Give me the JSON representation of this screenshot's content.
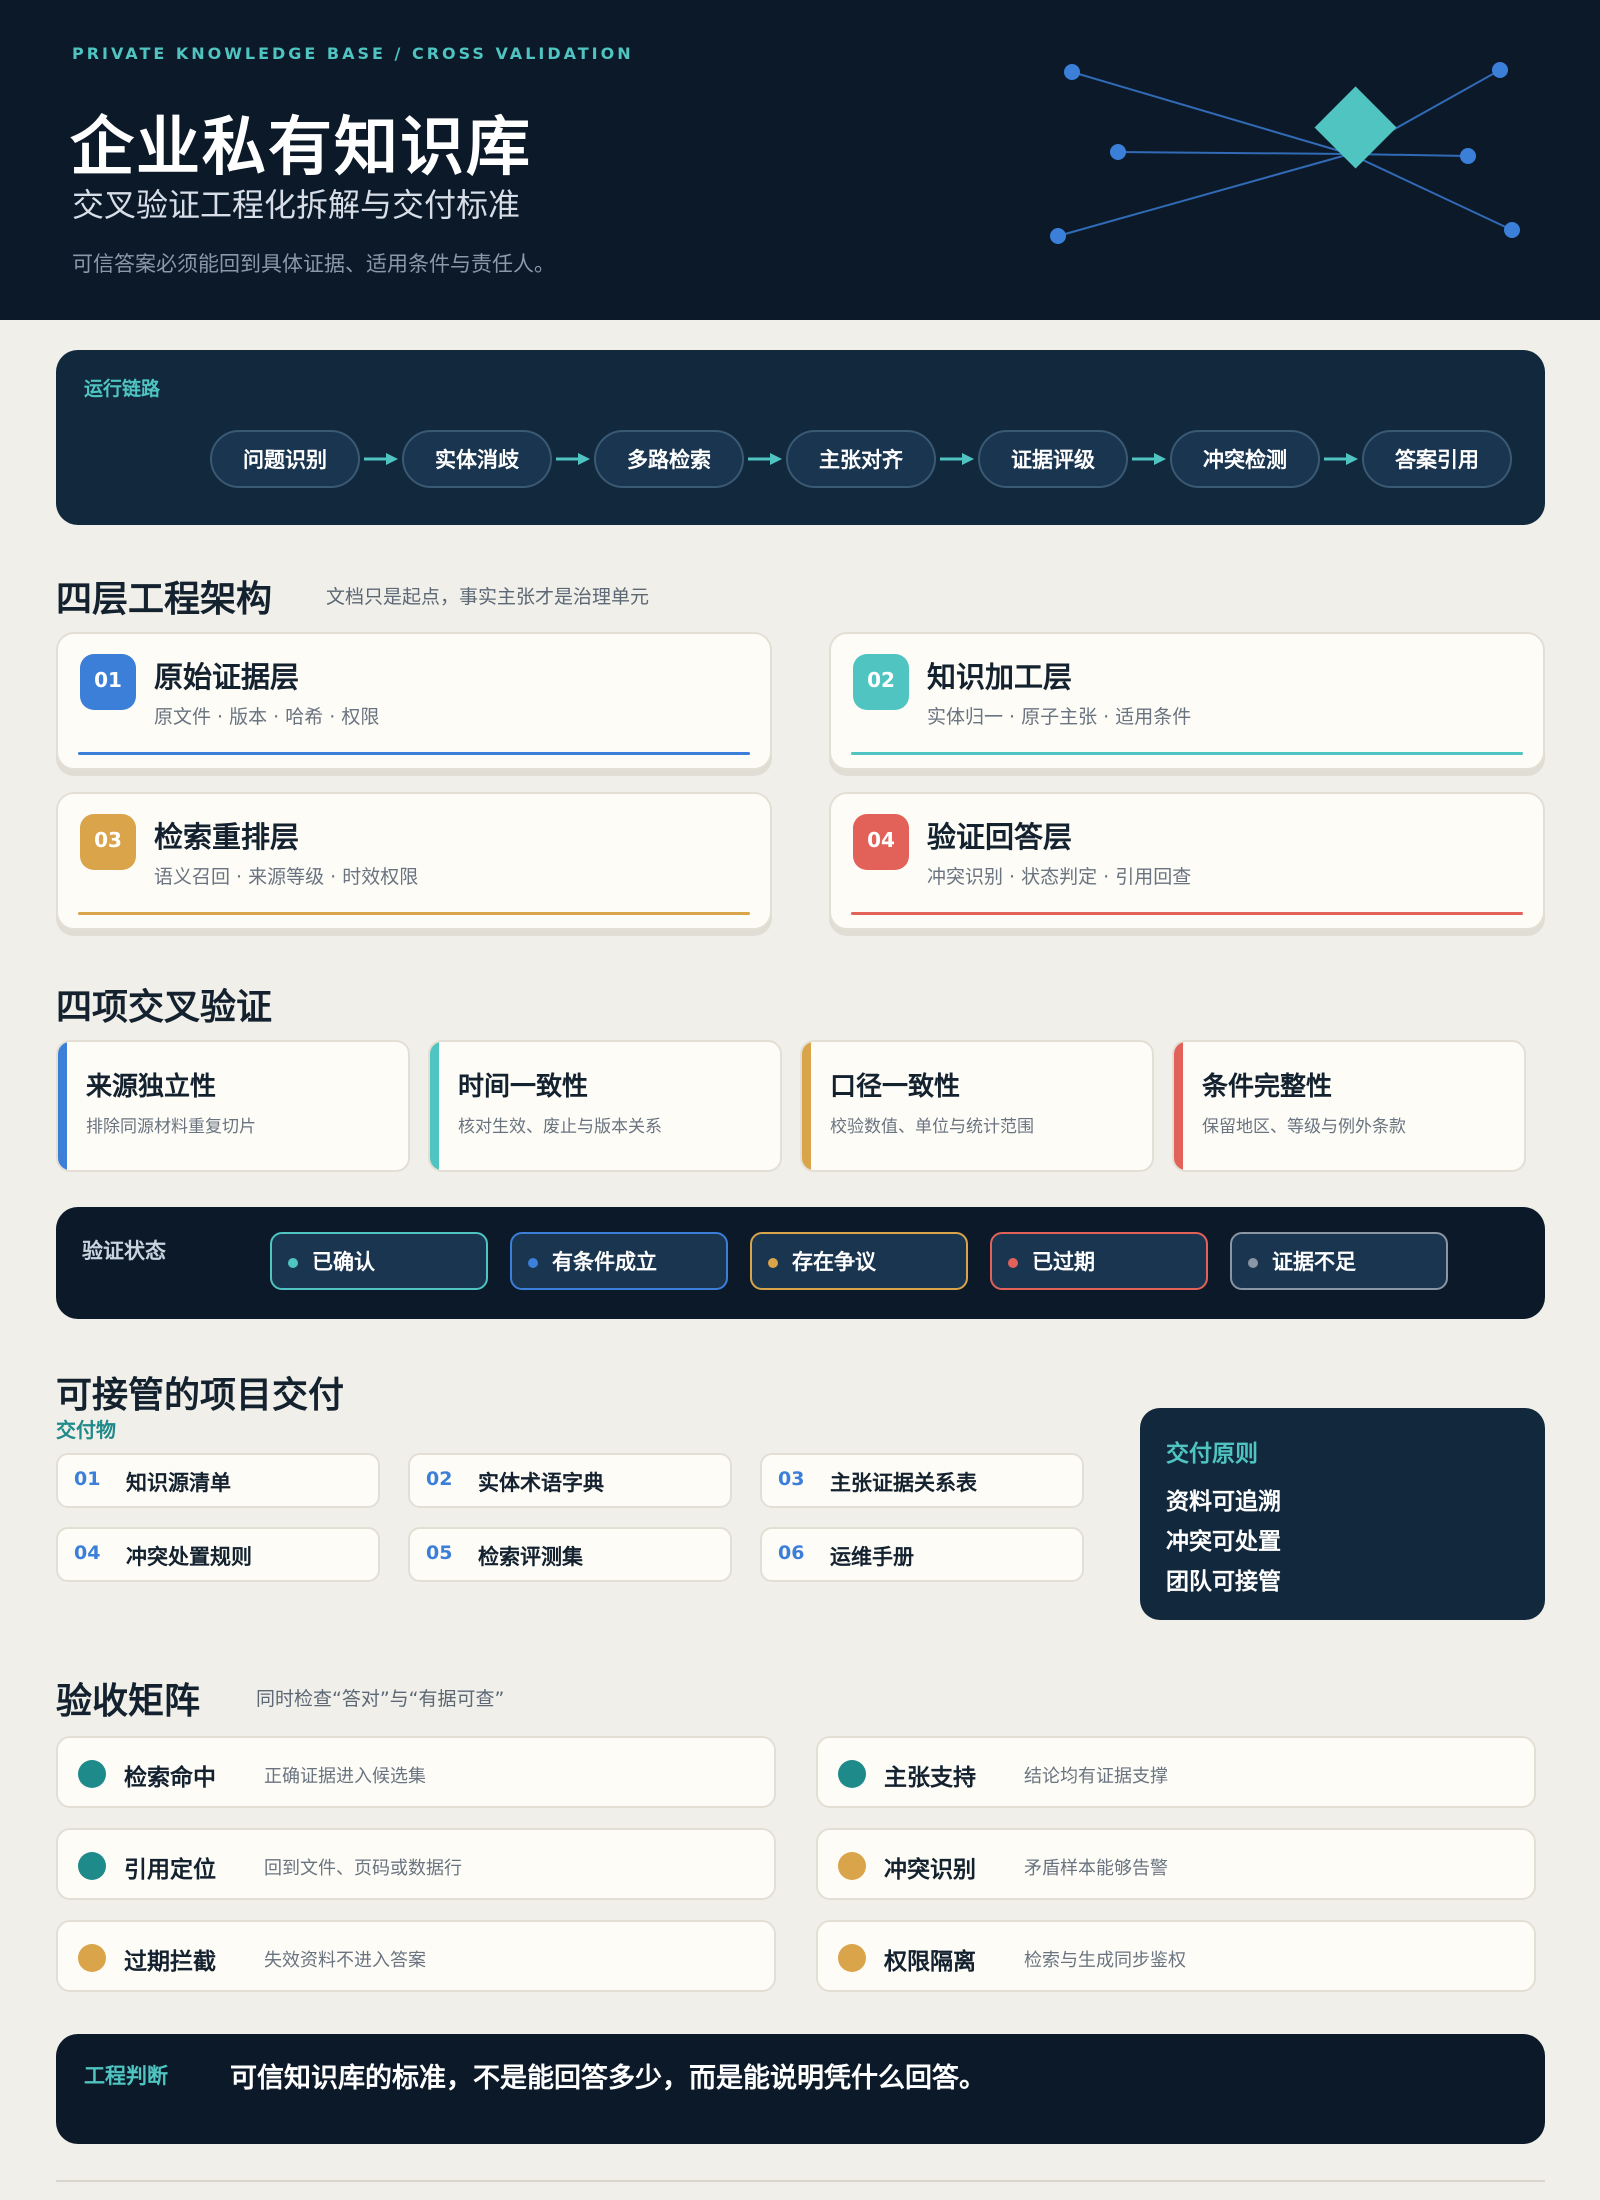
{
  "colors": {
    "navy": "#0b1929",
    "panel": "#12283d",
    "teal": "#4fc4c0",
    "blue": "#3b7fd9",
    "amber": "#d9a44a",
    "coral": "#e2625a",
    "gray": "#8a96a3",
    "deep_teal": "#1f8a8a"
  },
  "hero": {
    "eyebrow": "PRIVATE KNOWLEDGE BASE / CROSS VALIDATION",
    "title": "企业私有知识库",
    "subtitle": "交叉验证工程化拆解与交付标准",
    "tagline": "可信答案必须能回到具体证据、适用条件与责任人。"
  },
  "pipeline": {
    "label": "运行链路",
    "steps": [
      "问题识别",
      "实体消歧",
      "多路检索",
      "主张对齐",
      "证据评级",
      "冲突检测",
      "答案引用"
    ]
  },
  "layers": {
    "title": "四层工程架构",
    "subtitle": "文档只是起点，事实主张才是治理单元",
    "items": [
      {
        "num": "01",
        "title": "原始证据层",
        "desc": "原文件 · 版本 · 哈希 · 权限",
        "color": "#3b7fd9"
      },
      {
        "num": "02",
        "title": "知识加工层",
        "desc": "实体归一 · 原子主张 · 适用条件",
        "color": "#4fc4c0"
      },
      {
        "num": "03",
        "title": "检索重排层",
        "desc": "语义召回 · 来源等级 · 时效权限",
        "color": "#d9a44a"
      },
      {
        "num": "04",
        "title": "验证回答层",
        "desc": "冲突识别 · 状态判定 · 引用回查",
        "color": "#e2625a"
      }
    ]
  },
  "checks": {
    "title": "四项交叉验证",
    "items": [
      {
        "title": "来源独立性",
        "desc": "排除同源材料重复切片",
        "color": "#3b7fd9"
      },
      {
        "title": "时间一致性",
        "desc": "核对生效、废止与版本关系",
        "color": "#4fc4c0"
      },
      {
        "title": "口径一致性",
        "desc": "校验数值、单位与统计范围",
        "color": "#d9a44a"
      },
      {
        "title": "条件完整性",
        "desc": "保留地区、等级与例外条款",
        "color": "#e2625a"
      }
    ]
  },
  "status": {
    "label": "验证状态",
    "items": [
      {
        "text": "已确认",
        "color": "#4fc4c0"
      },
      {
        "text": "有条件成立",
        "color": "#3b7fd9"
      },
      {
        "text": "存在争议",
        "color": "#d9a44a"
      },
      {
        "text": "已过期",
        "color": "#e2625a"
      },
      {
        "text": "证据不足",
        "color": "#8a96a3"
      }
    ]
  },
  "delivery": {
    "title": "可接管的项目交付",
    "label": "交付物",
    "items": [
      {
        "num": "01",
        "text": "知识源清单"
      },
      {
        "num": "02",
        "text": "实体术语字典"
      },
      {
        "num": "03",
        "text": "主张证据关系表"
      },
      {
        "num": "04",
        "text": "冲突处置规则"
      },
      {
        "num": "05",
        "text": "检索评测集"
      },
      {
        "num": "06",
        "text": "运维手册"
      }
    ],
    "principle": {
      "title": "交付原则",
      "items": [
        "资料可追溯",
        "冲突可处置",
        "团队可接管"
      ]
    }
  },
  "acceptance": {
    "title": "验收矩阵",
    "subtitle": "同时检查“答对”与“有据可查”",
    "items": [
      {
        "name": "检索命中",
        "desc": "正确证据进入候选集",
        "color": "#1f8a8a"
      },
      {
        "name": "主张支持",
        "desc": "结论均有证据支撑",
        "color": "#1f8a8a"
      },
      {
        "name": "引用定位",
        "desc": "回到文件、页码或数据行",
        "color": "#1f8a8a"
      },
      {
        "name": "冲突识别",
        "desc": "矛盾样本能够告警",
        "color": "#d9a44a"
      },
      {
        "name": "过期拦截",
        "desc": "失效资料不进入答案",
        "color": "#d9a44a"
      },
      {
        "name": "权限隔离",
        "desc": "检索与生成同步鉴权",
        "color": "#d9a44a"
      }
    ]
  },
  "judgment": {
    "label": "工程判断",
    "text": "可信知识库的标准，不是能回答多少，而是能说明凭什么回答。"
  }
}
